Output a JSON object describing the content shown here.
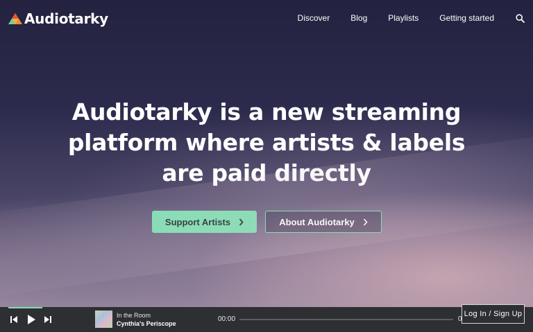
{
  "brand": {
    "name": "Audiotarky"
  },
  "nav": {
    "items": [
      "Discover",
      "Blog",
      "Playlists",
      "Getting started"
    ]
  },
  "hero": {
    "headline": "Audiotarky is a new streaming platform where artists & labels are paid directly",
    "primary_cta": "Support Artists",
    "secondary_cta": "About Audiotarky"
  },
  "player": {
    "track_title": "In the Room",
    "track_artist": "Cynthia's Periscope",
    "current_time": "00:00",
    "end_time_partial": "0",
    "progress": 0
  },
  "auth": {
    "login_label": "Log In / Sign Up"
  },
  "colors": {
    "accent": "#7ee0b2",
    "player_bg": "#2e2f33"
  }
}
